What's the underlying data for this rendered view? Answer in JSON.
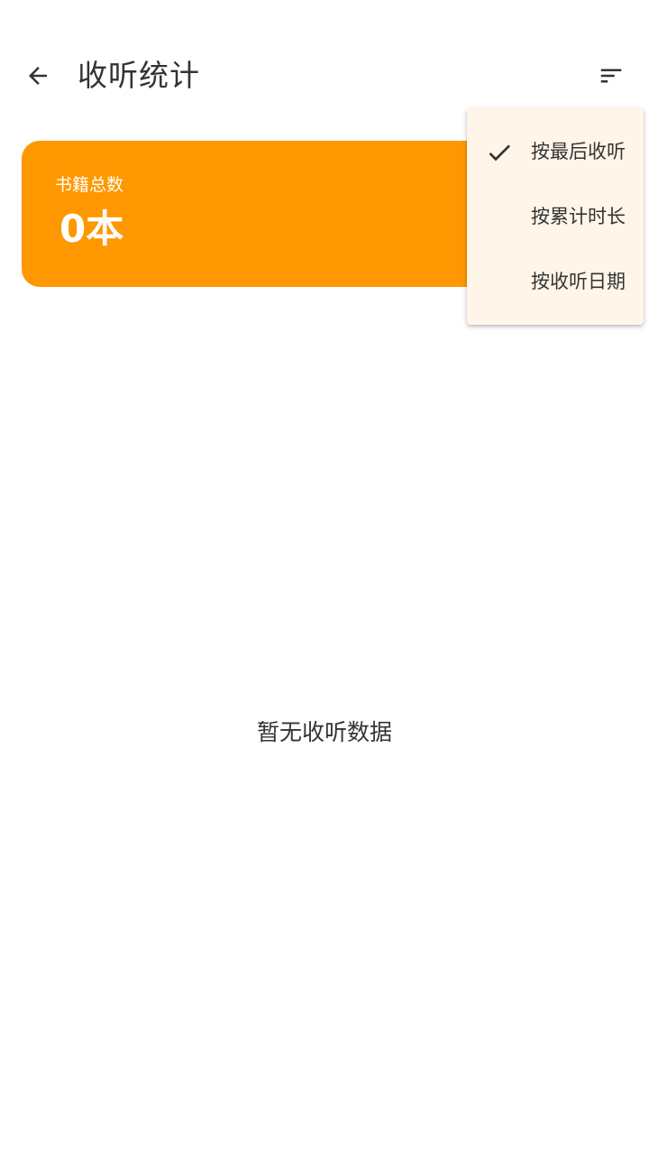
{
  "appbar": {
    "back_icon": "arrow-back-icon",
    "title": "收听统计",
    "sort_icon": "sort-icon"
  },
  "summary": {
    "label": "书籍总数",
    "value": "0本",
    "color": "#ff9800"
  },
  "empty_state": {
    "text": "暂无收听数据"
  },
  "sort_menu": {
    "items": [
      {
        "label": "按最后收听",
        "selected": true
      },
      {
        "label": "按累计时长",
        "selected": false
      },
      {
        "label": "按收听日期",
        "selected": false
      }
    ],
    "background": "#fff6e9"
  }
}
